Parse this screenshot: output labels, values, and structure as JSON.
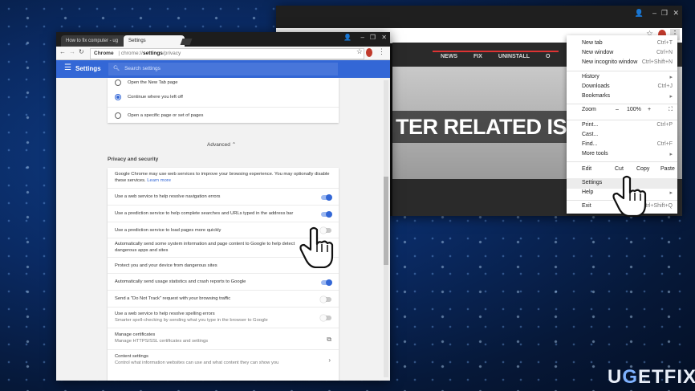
{
  "back_window": {
    "site_nav": [
      "NEWS",
      "FIX",
      "UNINSTALL",
      "O"
    ],
    "headline": "TER RELATED ISSUE"
  },
  "chrome_menu": {
    "items": [
      {
        "label": "New tab",
        "shortcut": "Ctrl+T"
      },
      {
        "label": "New window",
        "shortcut": "Ctrl+N"
      },
      {
        "label": "New incognito window",
        "shortcut": "Ctrl+Shift+N"
      },
      {
        "label": "History",
        "shortcut": "▸"
      },
      {
        "label": "Downloads",
        "shortcut": "Ctrl+J"
      },
      {
        "label": "Bookmarks",
        "shortcut": "▸"
      },
      {
        "label": "Print...",
        "shortcut": "Ctrl+P"
      },
      {
        "label": "Cast...",
        "shortcut": ""
      },
      {
        "label": "Find...",
        "shortcut": "Ctrl+F"
      },
      {
        "label": "More tools",
        "shortcut": "▸"
      },
      {
        "label": "Settings",
        "shortcut": ""
      },
      {
        "label": "Help",
        "shortcut": "▸"
      },
      {
        "label": "Exit",
        "shortcut": "Ctrl+Shift+Q"
      }
    ],
    "zoom_label": "Zoom",
    "zoom_minus": "–",
    "zoom_value": "100%",
    "zoom_plus": "+",
    "fullscreen_icon": "⛶",
    "edit_label": "Edit",
    "cut_label": "Cut",
    "copy_label": "Copy",
    "paste_label": "Paste"
  },
  "front_window": {
    "tabs": [
      {
        "label": "How to fix computer - ug"
      },
      {
        "label": "Settings"
      }
    ],
    "url_prefix": "Chrome",
    "url_host": "chrome://",
    "url_bold": "settings",
    "url_path": "/privacy",
    "header_title": "Settings",
    "search_placeholder": "Search settings",
    "startup": [
      "Open the New Tab page",
      "Continue where you left off",
      "Open a specific page or set of pages"
    ],
    "advanced_label": "Advanced",
    "section_title": "Privacy and security",
    "intro_text": "Google Chrome may use web services to improve your browsing experience. You may optionally disable these services.",
    "learn_more": "Learn more",
    "privacy_rows": [
      {
        "text": "Use a web service to help resolve navigation errors",
        "sub": "",
        "state": "on"
      },
      {
        "text": "Use a prediction service to help complete searches and URLs typed in the address bar",
        "sub": "",
        "state": "on"
      },
      {
        "text": "Use a prediction service to load pages more quickly",
        "sub": "",
        "state": "off"
      },
      {
        "text": "Automatically send some system information and page content to Google to help detect dangerous apps and sites",
        "sub": "",
        "state": "none"
      },
      {
        "text": "Protect you and your device from dangerous sites",
        "sub": "",
        "state": "none"
      },
      {
        "text": "Automatically send usage statistics and crash reports to Google",
        "sub": "",
        "state": "on"
      },
      {
        "text": "Send a \"Do Not Track\" request with your browsing traffic",
        "sub": "",
        "state": "off"
      },
      {
        "text": "Use a web service to help resolve spelling errors",
        "sub": "Smarter spell-checking by sending what you type in the browser to Google",
        "state": "off"
      },
      {
        "text": "Manage certificates",
        "sub": "Manage HTTPS/SSL certificates and settings",
        "state": "link"
      },
      {
        "text": "Content settings",
        "sub": "Control what information websites can use and what content they can show you",
        "state": "arrow"
      }
    ]
  },
  "watermark": {
    "pre": "U",
    "g": "G",
    "post": "ETFIX"
  }
}
